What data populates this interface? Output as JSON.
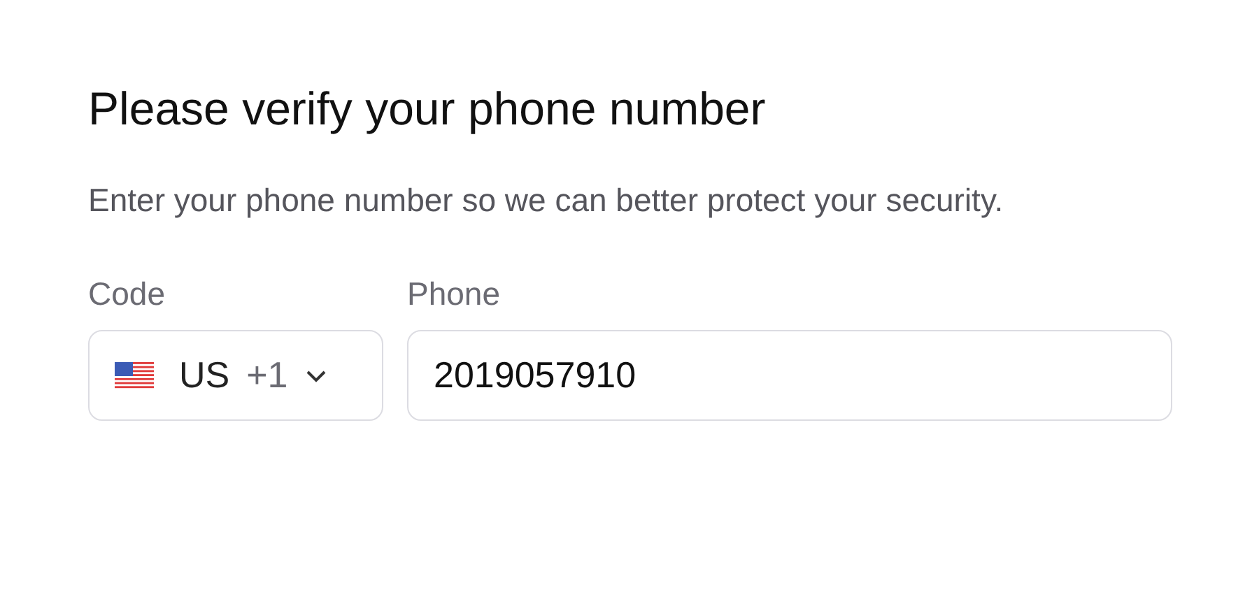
{
  "title": "Please verify your phone number",
  "description": "Enter your phone number so we can better protect your security.",
  "code": {
    "label": "Code",
    "country": "US",
    "dial": "+1"
  },
  "phone": {
    "label": "Phone",
    "value": "2019057910"
  }
}
